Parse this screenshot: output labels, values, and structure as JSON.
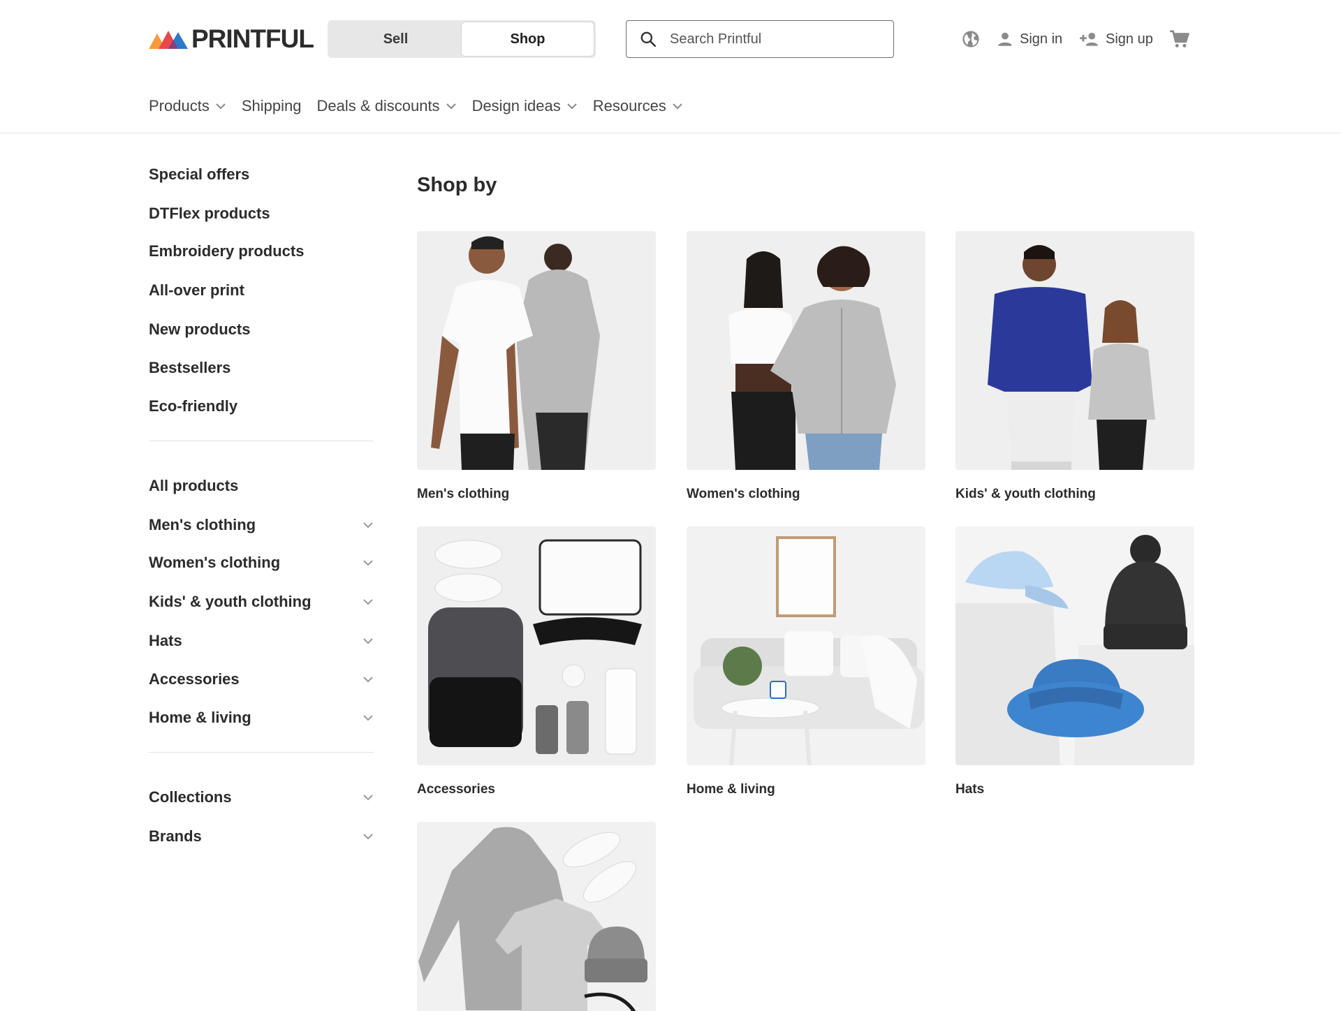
{
  "brand": {
    "name": "PRINTFUL",
    "colors": {
      "orange": "#f79a3d",
      "red": "#e8474c",
      "blue": "#2c79c7",
      "dark": "#2c2c2c"
    }
  },
  "mode_toggle": {
    "sell_label": "Sell",
    "shop_label": "Shop",
    "active": "Shop"
  },
  "search": {
    "placeholder": "Search Printful",
    "value": ""
  },
  "header_actions": {
    "globe_icon": "globe-icon",
    "sign_in_label": "Sign in",
    "sign_up_label": "Sign up",
    "cart_icon": "cart-icon"
  },
  "nav": [
    {
      "label": "Products",
      "has_dropdown": true
    },
    {
      "label": "Shipping",
      "has_dropdown": false
    },
    {
      "label": "Deals & discounts",
      "has_dropdown": true
    },
    {
      "label": "Design ideas",
      "has_dropdown": true
    },
    {
      "label": "Resources",
      "has_dropdown": true
    }
  ],
  "sidebar": {
    "featured": [
      {
        "label": "Special offers"
      },
      {
        "label": "DTFlex products"
      },
      {
        "label": "Embroidery products"
      },
      {
        "label": "All-over print"
      },
      {
        "label": "New products"
      },
      {
        "label": "Bestsellers"
      },
      {
        "label": "Eco-friendly"
      }
    ],
    "categories": [
      {
        "label": "All products",
        "expandable": false
      },
      {
        "label": "Men's clothing",
        "expandable": true
      },
      {
        "label": "Women's clothing",
        "expandable": true
      },
      {
        "label": "Kids' & youth clothing",
        "expandable": true
      },
      {
        "label": "Hats",
        "expandable": true
      },
      {
        "label": "Accessories",
        "expandable": true
      },
      {
        "label": "Home & living",
        "expandable": true
      }
    ],
    "groups": [
      {
        "label": "Collections",
        "expandable": true
      },
      {
        "label": "Brands",
        "expandable": true
      }
    ]
  },
  "main": {
    "title": "Shop by",
    "cards": [
      {
        "label": "Men's clothing",
        "image": "mens-clothing-photo"
      },
      {
        "label": "Women's clothing",
        "image": "womens-clothing-photo"
      },
      {
        "label": "Kids' & youth clothing",
        "image": "kids-clothing-photo"
      },
      {
        "label": "Accessories",
        "image": "accessories-photo"
      },
      {
        "label": "Home & living",
        "image": "home-living-photo"
      },
      {
        "label": "Hats",
        "image": "hats-photo"
      },
      {
        "label": "",
        "image": "apparel-flatlay-photo"
      }
    ]
  }
}
